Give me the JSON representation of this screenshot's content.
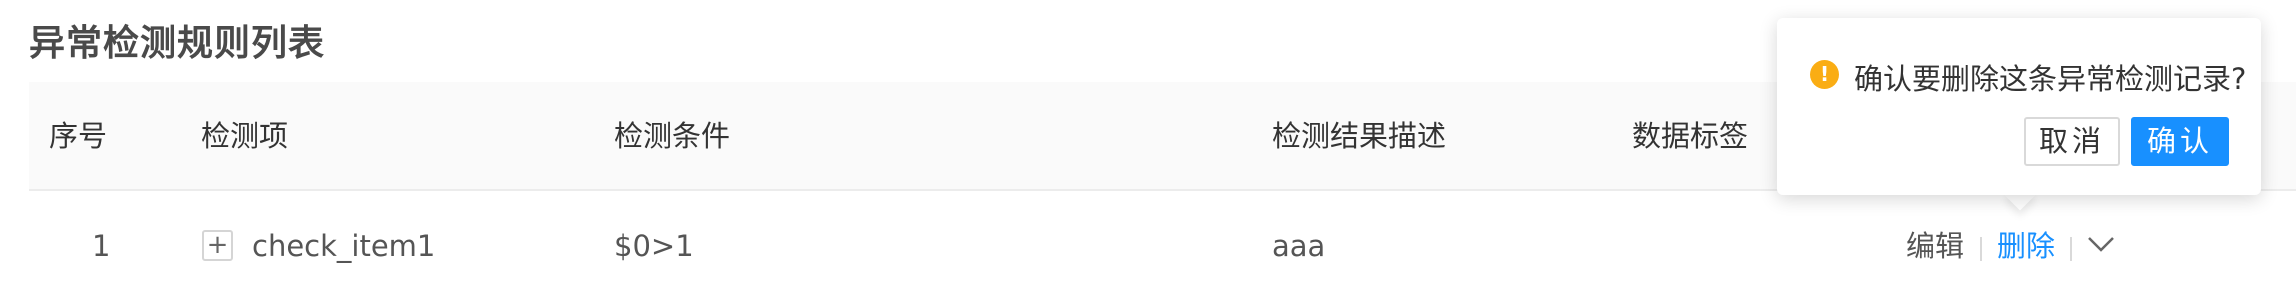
{
  "page": {
    "title": "异常检测规则列表"
  },
  "table": {
    "columns": [
      "序号",
      "检测项",
      "检测条件",
      "检测结果描述",
      "数据标签"
    ],
    "rows": [
      {
        "index": "1",
        "expand_symbol": "+",
        "item": "check_item1",
        "condition": "$0>1",
        "description": "aaa",
        "tag": "",
        "actions": {
          "edit": "编辑",
          "delete": "删除"
        }
      }
    ]
  },
  "popconfirm": {
    "icon_glyph": "!",
    "message": "确认要删除这条异常检测记录?",
    "cancel_label": "取消",
    "ok_label": "确认"
  },
  "colors": {
    "primary": "#1890ff",
    "warning": "#faad14",
    "header_bg": "#fafafa"
  },
  "icons": {
    "expand": "plus-icon",
    "more": "chevron-down-icon",
    "warning": "exclamation-circle-icon"
  }
}
